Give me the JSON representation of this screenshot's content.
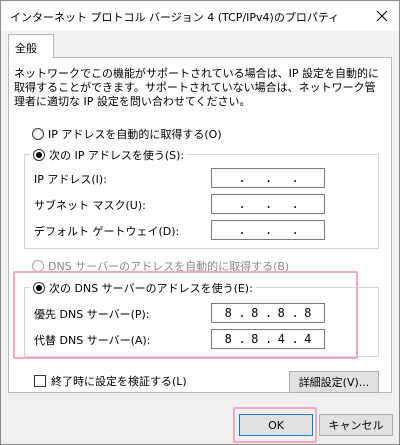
{
  "window": {
    "title": "インターネット プロトコル バージョン 4 (TCP/IPv4)のプロパティ"
  },
  "tabs": [
    "全般"
  ],
  "description": "ネットワークでこの機能がサポートされている場合は、IP 設定を自動的に取得することができます。サポートされていない場合は、ネットワーク管理者に適切な IP 設定を問い合わせてください。",
  "ip_section": {
    "auto_label": "IP アドレスを自動的に取得する(O)",
    "manual_label": "次の IP アドレスを使う(S):",
    "selected": "manual",
    "fields": [
      {
        "label": "IP アドレス(I):",
        "octets": [
          "",
          "",
          "",
          ""
        ]
      },
      {
        "label": "サブネット マスク(U):",
        "octets": [
          "",
          "",
          "",
          ""
        ]
      },
      {
        "label": "デフォルト ゲートウェイ(D):",
        "octets": [
          "",
          "",
          "",
          ""
        ]
      }
    ]
  },
  "dns_section": {
    "auto_label": "DNS サーバーのアドレスを自動的に取得する(B)",
    "manual_label": "次の DNS サーバーのアドレスを使う(E):",
    "selected": "manual",
    "auto_disabled": true,
    "fields": [
      {
        "label": "優先 DNS サーバー(P):",
        "octets": [
          "8",
          "8",
          "8",
          "8"
        ]
      },
      {
        "label": "代替 DNS サーバー(A):",
        "octets": [
          "8",
          "8",
          "4",
          "4"
        ]
      }
    ]
  },
  "validate_label": "終了時に設定を検証する(L)",
  "buttons": {
    "advanced": "詳細設定(V)...",
    "ok": "OK",
    "cancel": "キャンセル"
  },
  "highlight_color": "#f2a8c8"
}
